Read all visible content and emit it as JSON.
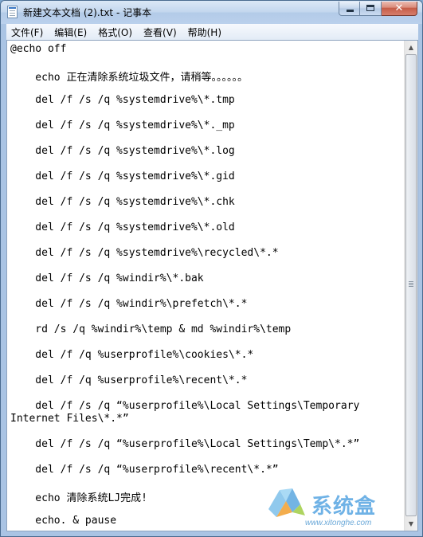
{
  "window": {
    "title": "新建文本文档 (2).txt - 记事本"
  },
  "menu": [
    {
      "label": "文件(F)"
    },
    {
      "label": "编辑(E)"
    },
    {
      "label": "格式(O)"
    },
    {
      "label": "查看(V)"
    },
    {
      "label": "帮助(H)"
    }
  ],
  "editor": {
    "lines": [
      "@echo off",
      "    echo 正在清除系统垃圾文件，请稍等。。。。。。",
      "    del /f /s /q %systemdrive%\\*.tmp",
      "    del /f /s /q %systemdrive%\\*._mp",
      "    del /f /s /q %systemdrive%\\*.log",
      "    del /f /s /q %systemdrive%\\*.gid",
      "    del /f /s /q %systemdrive%\\*.chk",
      "    del /f /s /q %systemdrive%\\*.old",
      "    del /f /s /q %systemdrive%\\recycled\\*.*",
      "    del /f /s /q %windir%\\*.bak",
      "    del /f /s /q %windir%\\prefetch\\*.*",
      "    rd /s /q %windir%\\temp & md %windir%\\temp",
      "    del /f /q %userprofile%\\cookies\\*.*",
      "    del /f /q %userprofile%\\recent\\*.*",
      "    del /f /s /q “%userprofile%\\Local Settings\\Temporary",
      "Internet Files\\*.*”",
      "    del /f /s /q “%userprofile%\\Local Settings\\Temp\\*.*”",
      "    del /f /s /q “%userprofile%\\recent\\*.*”",
      "    echo 清除系统LJ完成!",
      "    echo. & pause"
    ]
  },
  "watermark": {
    "name": "系统盒",
    "url": "www.xitonghe.com"
  },
  "icons": {
    "app": "notepad-icon",
    "minimize": "minimize-icon",
    "maximize": "maximize-icon",
    "close": "close-icon"
  }
}
